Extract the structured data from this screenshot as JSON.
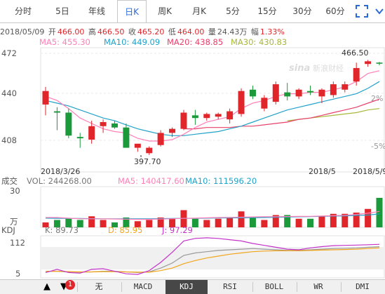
{
  "tabs": [
    {
      "label": "分时",
      "active": false
    },
    {
      "label": "5日",
      "active": false
    },
    {
      "label": "年线",
      "active": false
    },
    {
      "label": "日K",
      "active": true
    },
    {
      "label": "周K",
      "active": false
    },
    {
      "label": "月K",
      "active": false
    },
    {
      "label": "5分",
      "active": false
    },
    {
      "label": "15分",
      "active": false
    },
    {
      "label": "30分",
      "active": false
    },
    {
      "label": "60分",
      "active": false
    }
  ],
  "info": {
    "date": "2018/05/09",
    "open_label": "开",
    "open": "466.00",
    "high_label": "高",
    "high": "466.50",
    "close_label": "收",
    "close": "465.20",
    "low_label": "低",
    "low": "464.00",
    "vol_label": "量",
    "vol": "24.43万",
    "chg_label": "幅",
    "chg": "1.33%"
  },
  "ma": {
    "ma5": "MA5: 455.30",
    "ma10": "MA10: 449.09",
    "ma20": "MA20: 438.85",
    "ma30": "MA30: 430.83"
  },
  "colors": {
    "up": "#e0262b",
    "down": "#1a9a3a",
    "ma5": "#ff7fb8",
    "ma10": "#21a2c9",
    "ma20": "#e8406a",
    "ma30": "#a8b83a",
    "k": "#9a9a9a",
    "d": "#f2a51c",
    "j": "#c233c9"
  },
  "watermark": "新浪财经",
  "chart_data": {
    "type": "candlestick",
    "price_axis": {
      "ticks": [
        "472",
        "440",
        "408"
      ],
      "range": [
        395,
        476
      ]
    },
    "pct_axis": {
      "ticks": [
        "2%",
        "-5%"
      ]
    },
    "annotations": {
      "max": "466.50",
      "min": "397.70"
    },
    "x_labels": [
      "2018/3/26",
      "2018/5",
      "2018/5/9"
    ],
    "candles": [
      {
        "o": 435,
        "h": 448,
        "l": 427,
        "c": 445
      },
      {
        "o": 430,
        "h": 433,
        "l": 416,
        "c": 429
      },
      {
        "o": 429,
        "h": 432,
        "l": 410,
        "c": 412
      },
      {
        "o": 411,
        "h": 414,
        "l": 403,
        "c": 410
      },
      {
        "o": 409,
        "h": 423,
        "l": 406,
        "c": 419
      },
      {
        "o": 419,
        "h": 424,
        "l": 414,
        "c": 422
      },
      {
        "o": 421,
        "h": 423,
        "l": 417,
        "c": 418
      },
      {
        "o": 418,
        "h": 421,
        "l": 406,
        "c": 403
      },
      {
        "o": 403,
        "h": 406,
        "l": 400,
        "c": 406
      },
      {
        "o": 399,
        "h": 404,
        "l": 397.7,
        "c": 403
      },
      {
        "o": 405,
        "h": 416,
        "l": 404,
        "c": 414
      },
      {
        "o": 414,
        "h": 418,
        "l": 411,
        "c": 417
      },
      {
        "o": 417,
        "h": 431,
        "l": 416,
        "c": 429
      },
      {
        "o": 427,
        "h": 431,
        "l": 420,
        "c": 425
      },
      {
        "o": 425,
        "h": 429,
        "l": 423,
        "c": 428
      },
      {
        "o": 426,
        "h": 429,
        "l": 424,
        "c": 428
      },
      {
        "o": 424,
        "h": 432,
        "l": 421,
        "c": 430
      },
      {
        "o": 428,
        "h": 447,
        "l": 426,
        "c": 445
      },
      {
        "o": 446,
        "h": 449,
        "l": 439,
        "c": 441
      },
      {
        "o": 432,
        "h": 442,
        "l": 430,
        "c": 440
      },
      {
        "o": 437,
        "h": 452,
        "l": 435,
        "c": 450
      },
      {
        "o": 444,
        "h": 451,
        "l": 438,
        "c": 441
      },
      {
        "o": 441,
        "h": 447,
        "l": 439,
        "c": 446
      },
      {
        "o": 445,
        "h": 449,
        "l": 442,
        "c": 444
      },
      {
        "o": 441,
        "h": 447,
        "l": 436,
        "c": 446
      },
      {
        "o": 442,
        "h": 452,
        "l": 440,
        "c": 450
      },
      {
        "o": 446,
        "h": 452,
        "l": 444,
        "c": 450
      },
      {
        "o": 452,
        "h": 466,
        "l": 449,
        "c": 462
      },
      {
        "o": 465,
        "h": 468,
        "l": 463,
        "c": 467
      },
      {
        "o": 466,
        "h": 466.5,
        "l": 464,
        "c": 465.2
      }
    ],
    "ma5": [
      441,
      438,
      432,
      425,
      421,
      417,
      415,
      414,
      410,
      408,
      408,
      409,
      413,
      418,
      422,
      424,
      426,
      432,
      436,
      438,
      441,
      443,
      443,
      444,
      444,
      446,
      448,
      452,
      458,
      460
    ],
    "ma10": [
      438,
      436,
      434,
      431,
      428,
      425,
      423,
      420,
      417,
      415,
      413,
      412,
      412,
      413,
      414,
      415,
      417,
      419,
      422,
      425,
      428,
      431,
      433,
      435,
      437,
      439,
      441,
      443,
      447,
      452
    ],
    "ma20": [
      null,
      null,
      null,
      null,
      null,
      null,
      null,
      null,
      null,
      null,
      null,
      null,
      417,
      417,
      418,
      418,
      418,
      419,
      419,
      420,
      421,
      422,
      424,
      425,
      427,
      429,
      431,
      433,
      436,
      439
    ],
    "ma30": [
      null,
      null,
      null,
      null,
      null,
      null,
      null,
      null,
      null,
      null,
      null,
      null,
      null,
      null,
      null,
      null,
      null,
      null,
      null,
      null,
      null,
      423,
      424,
      425,
      426,
      427,
      428,
      429,
      431,
      432
    ],
    "volume": {
      "label": "成交",
      "vol_text": "VOL: 244268.00",
      "ma5_text": "MA5: 140417.60",
      "ma10_text": "MA10: 111596.20",
      "axis_ticks": [
        "30",
        "万"
      ],
      "range": [
        0,
        32
      ],
      "values": [
        4,
        6,
        7,
        6,
        9,
        6,
        4,
        8,
        5,
        6,
        8,
        7,
        14,
        7,
        6,
        7,
        8,
        13,
        8,
        6,
        10,
        10,
        7,
        7,
        9,
        11,
        11,
        12,
        15,
        24
      ],
      "ma5": [
        8,
        8,
        7.5,
        7,
        7,
        7,
        6.8,
        6.6,
        6.5,
        6.5,
        6.8,
        7,
        7.3,
        7.5,
        7.8,
        8,
        8.1,
        8.3,
        8.5,
        8.6,
        8.7,
        8.8,
        8.9,
        9,
        9.2,
        9.5,
        9.8,
        10.5,
        11.5,
        13
      ],
      "ma10": [
        7.5,
        7.4,
        7.3,
        7.2,
        7.1,
        7,
        7,
        7,
        7,
        7,
        7.1,
        7.2,
        7.3,
        7.4,
        7.5,
        7.6,
        7.7,
        7.8,
        7.9,
        8,
        8.2,
        8.4,
        8.6,
        8.8,
        9,
        9.2,
        9.4,
        9.7,
        10,
        11
      ]
    },
    "kdj": {
      "label": "KDJ",
      "k_text": "K: 89.73",
      "d_text": "D: 85.95",
      "j_text": "J: 97.29",
      "axis_ticks": [
        "112",
        "5"
      ],
      "range": [
        0,
        120
      ],
      "k": [
        12,
        12,
        10,
        9,
        10,
        12,
        12,
        10,
        8,
        10,
        22,
        38,
        62,
        70,
        74,
        78,
        80,
        82,
        84,
        82,
        80,
        78,
        78,
        80,
        82,
        84,
        85,
        86,
        88,
        89.7
      ],
      "d": [
        12,
        12,
        11,
        10,
        10,
        11,
        11,
        10,
        9,
        9,
        14,
        22,
        36,
        46,
        54,
        60,
        66,
        70,
        74,
        76,
        77,
        77,
        77,
        78,
        79,
        80,
        81,
        82,
        84,
        85.9
      ],
      "j": [
        8,
        18,
        8,
        6,
        18,
        20,
        12,
        4,
        2,
        14,
        40,
        72,
        108,
        116,
        118,
        116,
        112,
        108,
        100,
        94,
        88,
        82,
        80,
        86,
        90,
        93,
        94,
        95,
        96,
        97.3
      ]
    }
  },
  "bottom": {
    "buttons": [
      "无",
      "MACD",
      "KDJ",
      "RSI",
      "BOLL",
      "WR",
      "DMI"
    ],
    "active": "KDJ",
    "badge": "1"
  }
}
